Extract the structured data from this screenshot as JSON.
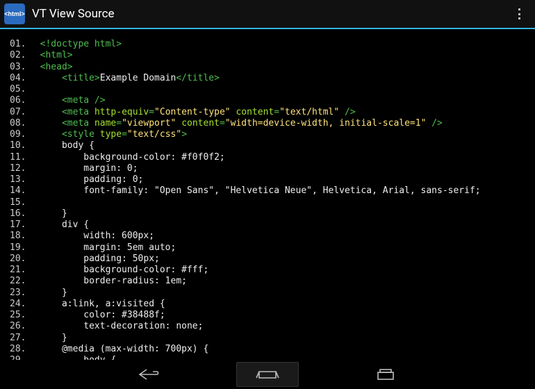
{
  "header": {
    "app_icon_label": "<html>",
    "title": "VT View Source"
  },
  "code": {
    "lines": [
      {
        "n": "01.",
        "tokens": [
          [
            "tag",
            "<!doctype html>"
          ]
        ]
      },
      {
        "n": "02.",
        "tokens": [
          [
            "tag",
            "<html>"
          ]
        ]
      },
      {
        "n": "03.",
        "tokens": [
          [
            "tag",
            "<head>"
          ]
        ]
      },
      {
        "n": "04.",
        "tokens": [
          [
            "text",
            "    "
          ],
          [
            "tag",
            "<title>"
          ],
          [
            "text",
            "Example Domain"
          ],
          [
            "tag",
            "</title>"
          ]
        ]
      },
      {
        "n": "05.",
        "tokens": []
      },
      {
        "n": "06.",
        "tokens": [
          [
            "text",
            "    "
          ],
          [
            "tag",
            "<meta />"
          ]
        ]
      },
      {
        "n": "07.",
        "tokens": [
          [
            "text",
            "    "
          ],
          [
            "tag",
            "<meta "
          ],
          [
            "attr",
            "http-equiv"
          ],
          [
            "tag",
            "="
          ],
          [
            "str",
            "\"Content-type\""
          ],
          [
            "tag",
            " "
          ],
          [
            "attr",
            "content"
          ],
          [
            "tag",
            "="
          ],
          [
            "str",
            "\"text/html\""
          ],
          [
            "tag",
            " />"
          ]
        ]
      },
      {
        "n": "08.",
        "tokens": [
          [
            "text",
            "    "
          ],
          [
            "tag",
            "<meta "
          ],
          [
            "attr",
            "name"
          ],
          [
            "tag",
            "="
          ],
          [
            "str",
            "\"viewport\""
          ],
          [
            "tag",
            " "
          ],
          [
            "attr",
            "content"
          ],
          [
            "tag",
            "="
          ],
          [
            "str",
            "\"width=device-width, initial-scale=1\""
          ],
          [
            "tag",
            " />"
          ]
        ]
      },
      {
        "n": "09.",
        "tokens": [
          [
            "text",
            "    "
          ],
          [
            "tag",
            "<style "
          ],
          [
            "attr",
            "type"
          ],
          [
            "tag",
            "="
          ],
          [
            "str",
            "\"text/css\""
          ],
          [
            "tag",
            ">"
          ]
        ]
      },
      {
        "n": "10.",
        "tokens": [
          [
            "text",
            "    body {"
          ]
        ]
      },
      {
        "n": "11.",
        "tokens": [
          [
            "text",
            "        background-color: #f0f0f2;"
          ]
        ]
      },
      {
        "n": "12.",
        "tokens": [
          [
            "text",
            "        margin: 0;"
          ]
        ]
      },
      {
        "n": "13.",
        "tokens": [
          [
            "text",
            "        padding: 0;"
          ]
        ]
      },
      {
        "n": "14.",
        "tokens": [
          [
            "text",
            "        font-family: \"Open Sans\", \"Helvetica Neue\", Helvetica, Arial, sans-serif;"
          ]
        ]
      },
      {
        "n": "15.",
        "tokens": []
      },
      {
        "n": "16.",
        "tokens": [
          [
            "text",
            "    }"
          ]
        ]
      },
      {
        "n": "17.",
        "tokens": [
          [
            "text",
            "    div {"
          ]
        ]
      },
      {
        "n": "18.",
        "tokens": [
          [
            "text",
            "        width: 600px;"
          ]
        ]
      },
      {
        "n": "19.",
        "tokens": [
          [
            "text",
            "        margin: 5em auto;"
          ]
        ]
      },
      {
        "n": "20.",
        "tokens": [
          [
            "text",
            "        padding: 50px;"
          ]
        ]
      },
      {
        "n": "21.",
        "tokens": [
          [
            "text",
            "        background-color: #fff;"
          ]
        ]
      },
      {
        "n": "22.",
        "tokens": [
          [
            "text",
            "        border-radius: 1em;"
          ]
        ]
      },
      {
        "n": "23.",
        "tokens": [
          [
            "text",
            "    }"
          ]
        ]
      },
      {
        "n": "24.",
        "tokens": [
          [
            "text",
            "    a:link, a:visited {"
          ]
        ]
      },
      {
        "n": "25.",
        "tokens": [
          [
            "text",
            "        color: #38488f;"
          ]
        ]
      },
      {
        "n": "26.",
        "tokens": [
          [
            "text",
            "        text-decoration: none;"
          ]
        ]
      },
      {
        "n": "27.",
        "tokens": [
          [
            "text",
            "    }"
          ]
        ]
      },
      {
        "n": "28.",
        "tokens": [
          [
            "text",
            "    @media (max-width: 700px) {"
          ]
        ]
      },
      {
        "n": "29.",
        "tokens": [
          [
            "text",
            "        body {"
          ]
        ]
      }
    ]
  }
}
